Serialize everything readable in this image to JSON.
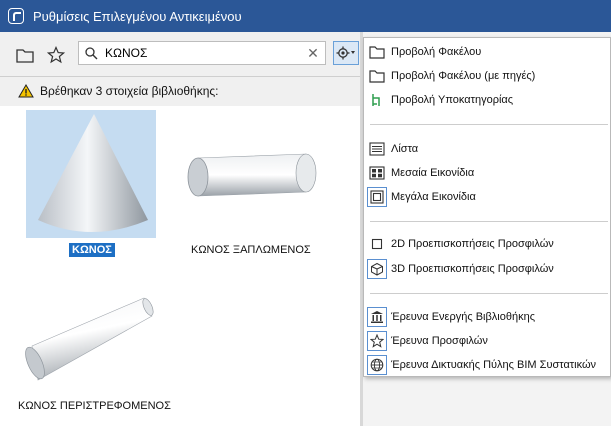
{
  "window": {
    "title": "Ρυθμίσεις Επιλεγμένου Αντικειμένου"
  },
  "toolbar": {
    "folder_icon": "folder-icon",
    "favorites_icon": "star-icon",
    "search_value": "ΚΩΝΟΣ",
    "view_options_icon": "view-settings-icon"
  },
  "status": {
    "message": "Βρέθηκαν 3 στοιχεία βιβλιοθήκης:"
  },
  "results": [
    {
      "label": "ΚΩΝΟΣ",
      "selected": true
    },
    {
      "label": "ΚΩΝΟΣ ΞΑΠΛΩΜΕΝΟΣ",
      "selected": false
    },
    {
      "label": "ΚΩΝΟΣ ΠΕΡΙΣΤΡΕΦΟΜΕΝΟΣ",
      "selected": false
    }
  ],
  "menu": {
    "items": [
      {
        "label": "Προβολή Φακέλου",
        "icon": "folder-icon"
      },
      {
        "label": "Προβολή Φακέλου (με πηγές)",
        "icon": "folder-icon"
      },
      {
        "label": "Προβολή Υποκατηγορίας",
        "icon": "subcategory-icon"
      },
      {
        "label": "Λίστα",
        "icon": "list-icon"
      },
      {
        "label": "Μεσαία Εικονίδια",
        "icon": "medium-icons-icon"
      },
      {
        "label": "Μεγάλα Εικονίδια",
        "icon": "large-icons-icon"
      },
      {
        "label": "2D Προεπισκοπήσεις Προσφιλών",
        "icon": "square-icon"
      },
      {
        "label": "3D Προεπισκοπήσεις Προσφιλών",
        "icon": "cube-icon"
      },
      {
        "label": "Έρευνα Ενεργής Βιβλιοθήκης",
        "icon": "library-icon"
      },
      {
        "label": "Έρευνα Προσφιλών",
        "icon": "star-icon"
      },
      {
        "label": "Έρευνα Δικτυακής Πύλης BIM Συστατικών",
        "icon": "globe-icon"
      }
    ]
  },
  "colors": {
    "titlebar": "#2b5797",
    "selection": "#1d6fc4",
    "accent_green": "#2e9e4f"
  }
}
